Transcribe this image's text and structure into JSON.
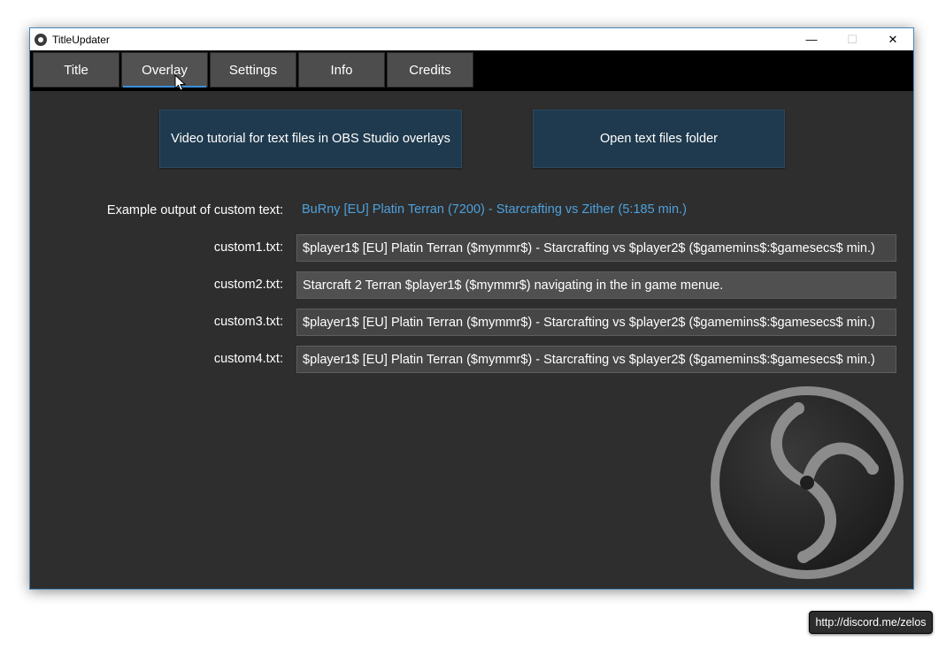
{
  "window": {
    "title": "TitleUpdater",
    "controls": {
      "minimize": "—",
      "maximize": "☐",
      "close": "✕"
    }
  },
  "tabs": [
    {
      "label": "Title"
    },
    {
      "label": "Overlay",
      "active": true
    },
    {
      "label": "Settings"
    },
    {
      "label": "Info"
    },
    {
      "label": "Credits"
    }
  ],
  "buttons": {
    "video_tutorial": "Video tutorial for text files in OBS Studio overlays",
    "open_folder": "Open text files folder"
  },
  "example": {
    "label": "Example output of custom text:",
    "value": "BuRny [EU] Platin Terran (7200) - Starcrafting vs Zither (5:185 min.)"
  },
  "custom_fields": [
    {
      "label": "custom1.txt:",
      "value": "$player1$ [EU] Platin Terran ($mymmr$) - Starcrafting vs $player2$ ($gamemins$:$gamesecs$ min.)"
    },
    {
      "label": "custom2.txt:",
      "value": "Starcraft 2 Terran $player1$ ($mymmr$) navigating in the in game menue."
    },
    {
      "label": "custom3.txt:",
      "value": "$player1$ [EU] Platin Terran ($mymmr$) - Starcrafting vs $player2$ ($gamemins$:$gamesecs$ min.)"
    },
    {
      "label": "custom4.txt:",
      "value": "$player1$ [EU] Platin Terran ($mymmr$) - Starcrafting vs $player2$ ($gamemins$:$gamesecs$ min.)"
    }
  ],
  "logo": {
    "icon": "obs-studio-logo"
  },
  "tooltip": {
    "text": "http://discord.me/zelos"
  },
  "colors": {
    "accent": "#3b8ed8",
    "example_text": "#4ea1dc",
    "button_bg": "#1f3a4e",
    "panel_bg": "#2e2e2e"
  }
}
